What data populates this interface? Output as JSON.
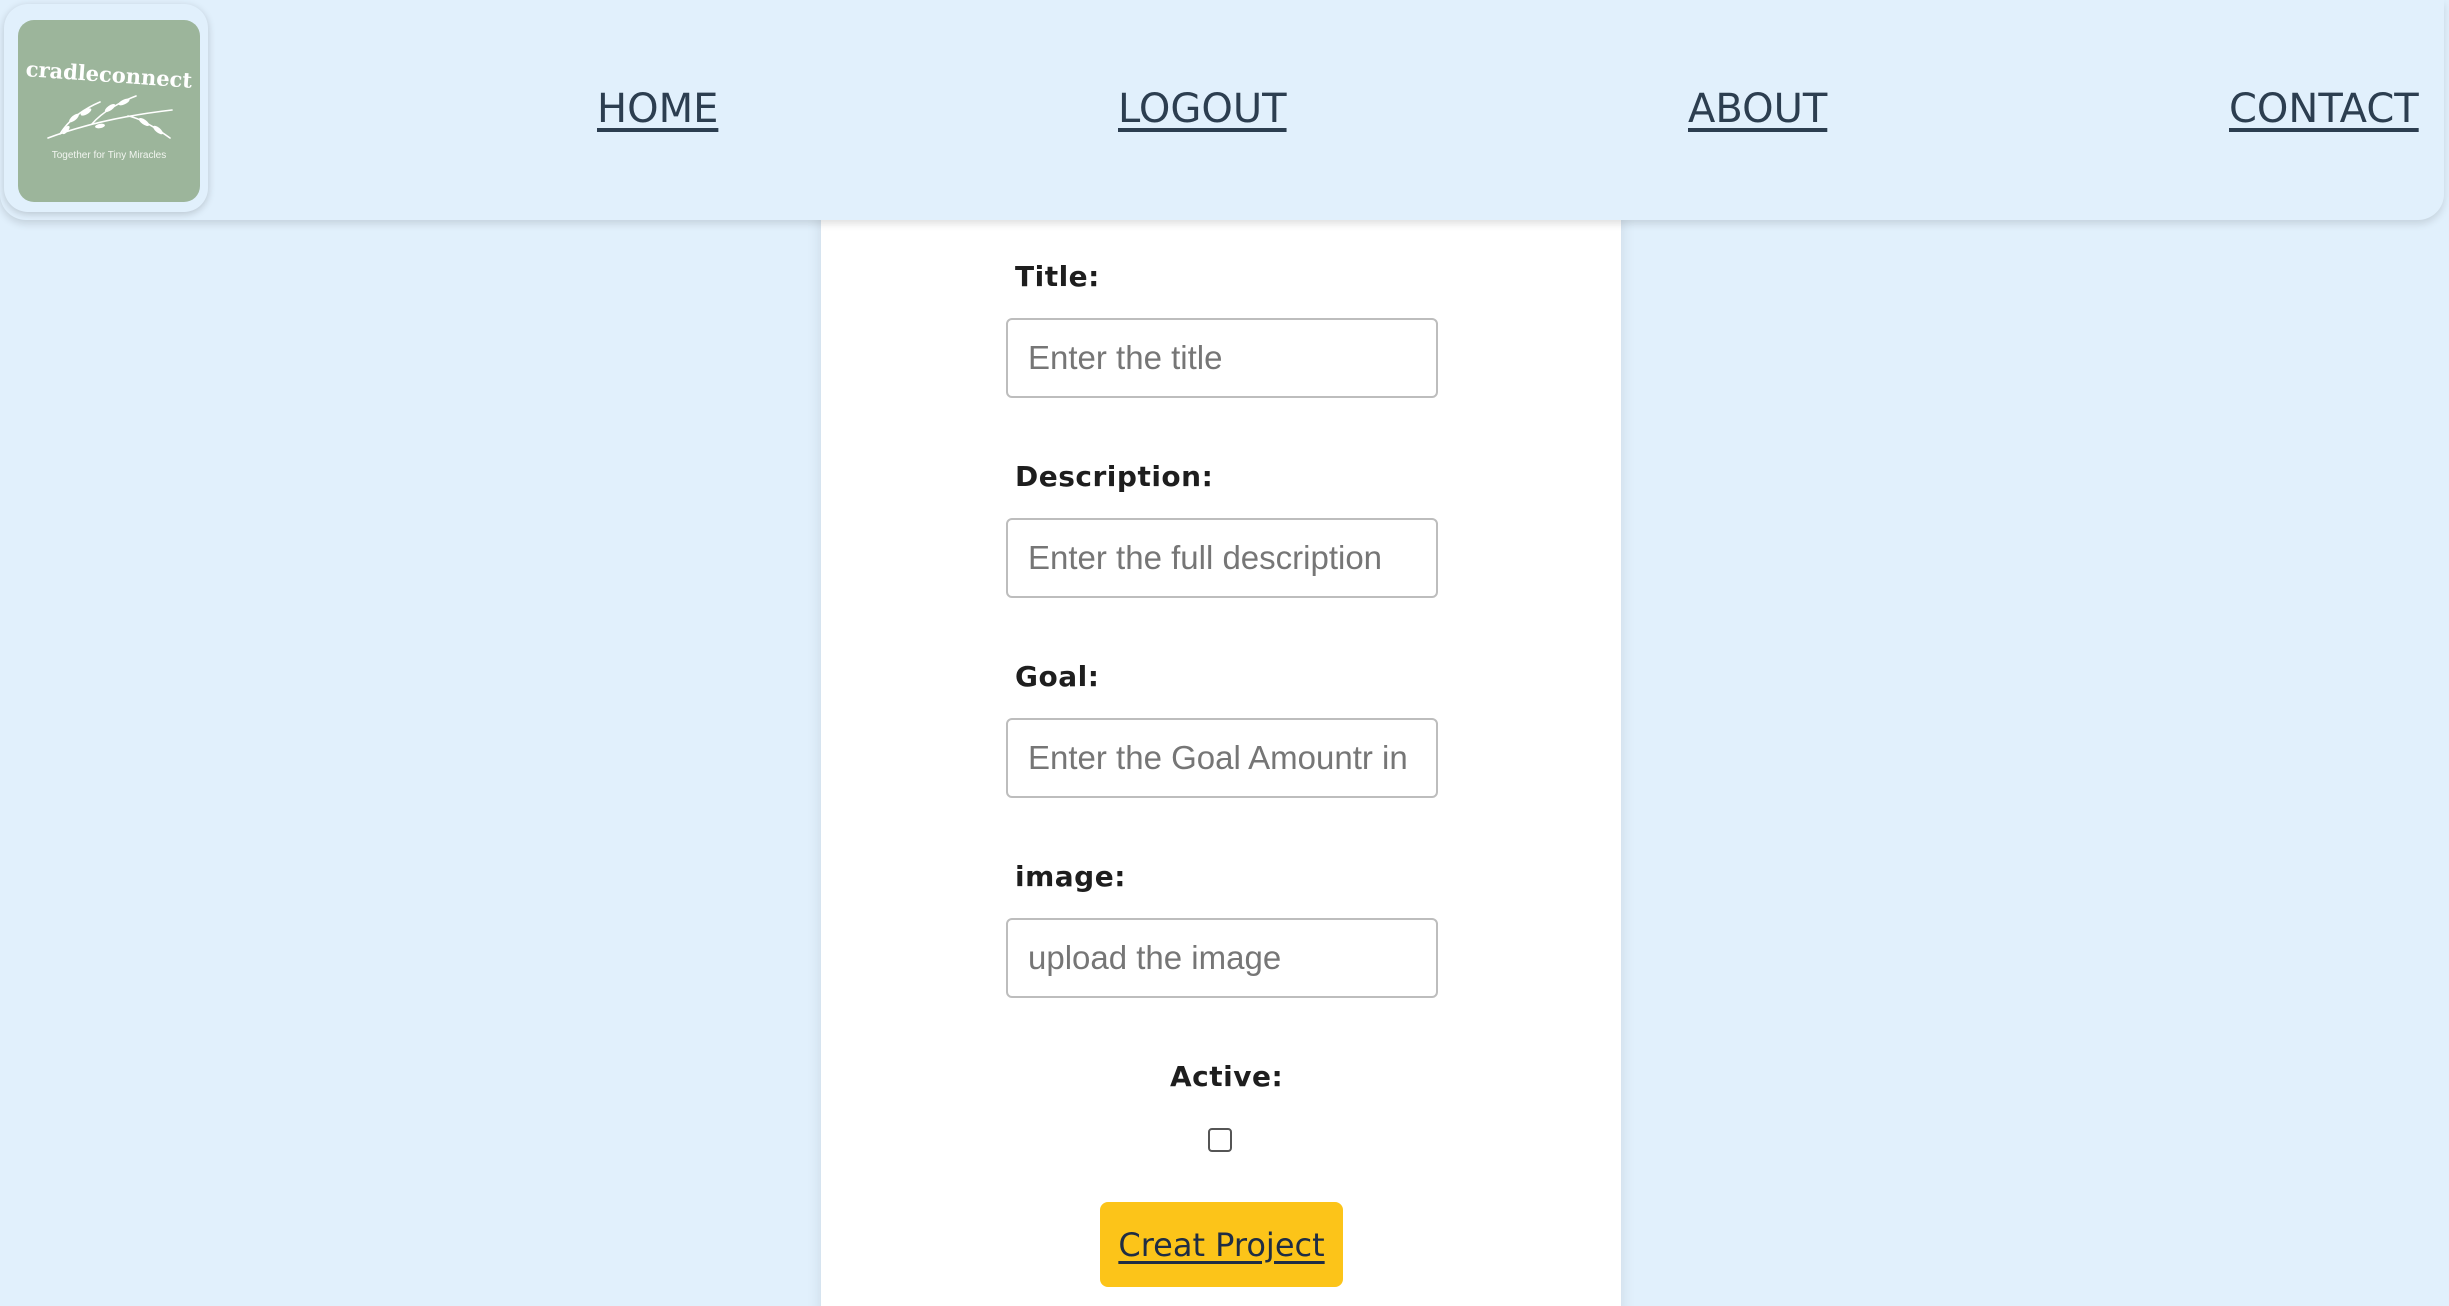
{
  "header": {
    "logo": {
      "name": "cradleconnect",
      "tagline": "Together for Tiny Miracles",
      "color": "#9cb59b"
    },
    "nav": [
      {
        "label": "HOME"
      },
      {
        "label": "LOGOUT"
      },
      {
        "label": "ABOUT"
      },
      {
        "label": "CONTACT"
      }
    ]
  },
  "form": {
    "title": {
      "label": "Title:",
      "placeholder": "Enter the title"
    },
    "description": {
      "label": "Description:",
      "placeholder": "Enter the full description"
    },
    "goal": {
      "label": "Goal:",
      "placeholder": "Enter the Goal Amountr in"
    },
    "image": {
      "label": "image:",
      "placeholder": "upload the image"
    },
    "active": {
      "label": "Active:",
      "checked": false
    },
    "submit_label": "Creat Project"
  },
  "colors": {
    "background": "#e1f0fc",
    "button": "#fcc419",
    "nav_text": "#2c3e50"
  }
}
